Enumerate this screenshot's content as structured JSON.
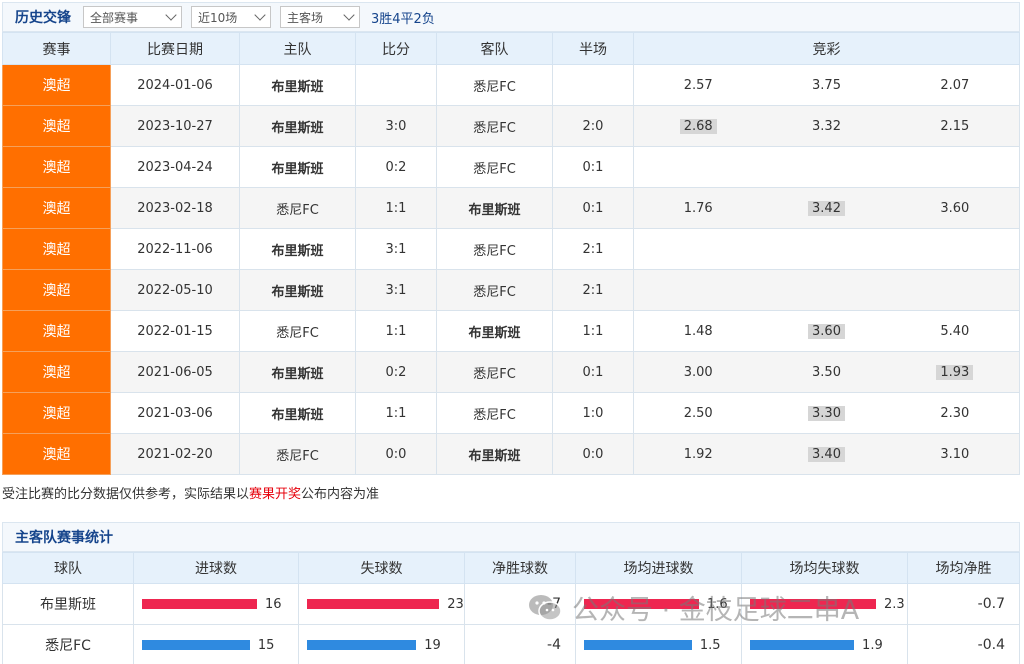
{
  "history": {
    "title": "历史交锋",
    "filters": {
      "competition": "全部赛事",
      "range": "近10场",
      "venue": "主客场"
    },
    "record": "3胜4平2负",
    "headers": [
      "赛事",
      "比赛日期",
      "主队",
      "比分",
      "客队",
      "半场",
      "竞彩"
    ],
    "rows": [
      {
        "league": "澳超",
        "date": "2024-01-06",
        "home": "布里斯班",
        "score": "",
        "away": "悉尼FC",
        "half": "",
        "odds": [
          "2.57",
          "3.75",
          "2.07"
        ],
        "hl": -1
      },
      {
        "league": "澳超",
        "date": "2023-10-27",
        "home": "布里斯班",
        "score": "3:0",
        "away": "悉尼FC",
        "half": "2:0",
        "odds": [
          "2.68",
          "3.32",
          "2.15"
        ],
        "hl": 0
      },
      {
        "league": "澳超",
        "date": "2023-04-24",
        "home": "布里斯班",
        "score": "0:2",
        "away": "悉尼FC",
        "half": "0:1",
        "odds": [
          "",
          "",
          ""
        ],
        "hl": -1
      },
      {
        "league": "澳超",
        "date": "2023-02-18",
        "home": "悉尼FC",
        "score": "1:1",
        "away": "布里斯班",
        "half": "0:1",
        "odds": [
          "1.76",
          "3.42",
          "3.60"
        ],
        "hl": 1
      },
      {
        "league": "澳超",
        "date": "2022-11-06",
        "home": "布里斯班",
        "score": "3:1",
        "away": "悉尼FC",
        "half": "2:1",
        "odds": [
          "",
          "",
          ""
        ],
        "hl": -1
      },
      {
        "league": "澳超",
        "date": "2022-05-10",
        "home": "布里斯班",
        "score": "3:1",
        "away": "悉尼FC",
        "half": "2:1",
        "odds": [
          "",
          "",
          ""
        ],
        "hl": -1
      },
      {
        "league": "澳超",
        "date": "2022-01-15",
        "home": "悉尼FC",
        "score": "1:1",
        "away": "布里斯班",
        "half": "1:1",
        "odds": [
          "1.48",
          "3.60",
          "5.40"
        ],
        "hl": 1
      },
      {
        "league": "澳超",
        "date": "2021-06-05",
        "home": "布里斯班",
        "score": "0:2",
        "away": "悉尼FC",
        "half": "0:1",
        "odds": [
          "3.00",
          "3.50",
          "1.93"
        ],
        "hl": 2
      },
      {
        "league": "澳超",
        "date": "2021-03-06",
        "home": "布里斯班",
        "score": "1:1",
        "away": "悉尼FC",
        "half": "1:0",
        "odds": [
          "2.50",
          "3.30",
          "2.30"
        ],
        "hl": 1
      },
      {
        "league": "澳超",
        "date": "2021-02-20",
        "home": "悉尼FC",
        "score": "0:0",
        "away": "布里斯班",
        "half": "0:0",
        "odds": [
          "1.92",
          "3.40",
          "3.10"
        ],
        "hl": 1
      }
    ]
  },
  "note": {
    "before": "受注比赛的比分数据仅供参考，实际结果以",
    "link": "赛果开奖",
    "after": "公布内容为准"
  },
  "stats": {
    "title": "主客队赛事统计",
    "headers": [
      "球队",
      "进球数",
      "失球数",
      "净胜球数",
      "场均进球数",
      "场均失球数",
      "场均净胜"
    ],
    "rows": [
      {
        "team": "布里斯班",
        "goals": "16",
        "conceded": "23",
        "net": "-7",
        "avg_goals": "1.6",
        "avg_conceded": "2.3",
        "avg_net": "-0.7",
        "color": "#ee2650"
      },
      {
        "team": "悉尼FC",
        "goals": "15",
        "conceded": "19",
        "net": "-4",
        "avg_goals": "1.5",
        "avg_conceded": "1.9",
        "avg_net": "-0.4",
        "color": "#2f8ae0"
      }
    ]
  },
  "watermark": "公众号 · 金枝足球二串A"
}
